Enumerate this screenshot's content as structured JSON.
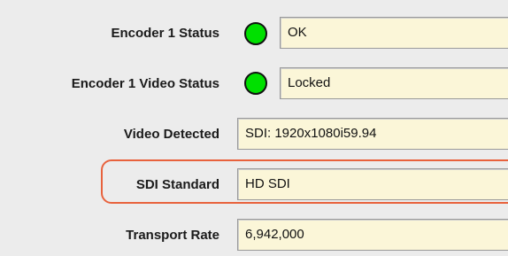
{
  "rows": [
    {
      "label": "Encoder 1 Status",
      "value": "OK",
      "indicator": "green"
    },
    {
      "label": "Encoder 1 Video Status",
      "value": "Locked",
      "indicator": "green"
    },
    {
      "label": "Video Detected",
      "value": "SDI: 1920x1080i59.94"
    },
    {
      "label": "SDI Standard",
      "value": "HD SDI",
      "highlighted": true
    },
    {
      "label": "Transport Rate",
      "value": "6,942,000"
    }
  ],
  "colors": {
    "indicator_ok": "#00e000",
    "field_background": "#fbf6d8",
    "highlight_outline": "#e8623d",
    "panel_background": "#ececec"
  }
}
